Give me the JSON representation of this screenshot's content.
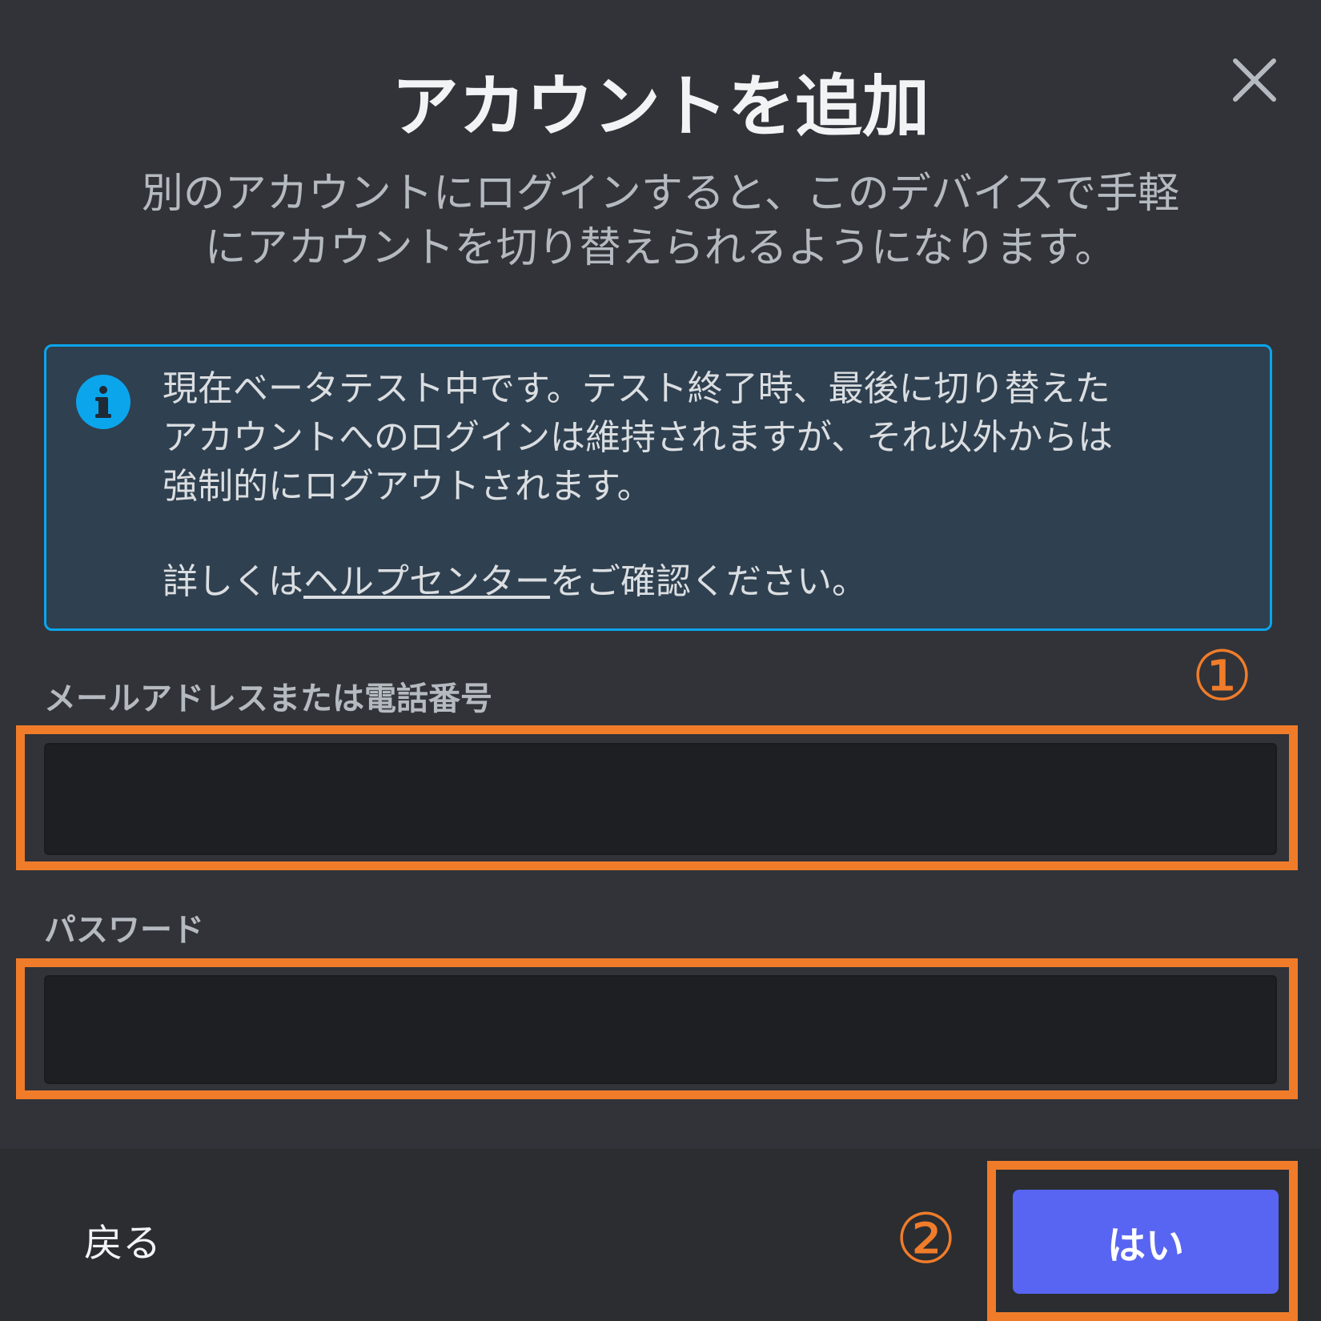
{
  "dialog": {
    "title": "アカウントを追加",
    "subtitle_lines": [
      "別のアカウントにログインすると、このデバイスで手軽",
      "にアカウントを切り替えられるようになります。"
    ],
    "close_icon": "close-icon"
  },
  "notice": {
    "icon": "info-icon",
    "lines": [
      "現在ベータテスト中です。テスト終了時、最後に切り替えた",
      "アカウントへのログインは維持されますが、それ以外からは",
      "強制的にログアウトされます。"
    ],
    "help_prefix": "詳しくは",
    "help_link": "ヘルプセンター",
    "help_suffix": "をご確認ください。"
  },
  "form": {
    "email_label": "メールアドレスまたは電話番号",
    "email_value": "",
    "password_label": "パスワード",
    "password_value": ""
  },
  "annotations": {
    "step_1": "①",
    "step_2": "②",
    "highlight_color": "#f07c2a"
  },
  "footer": {
    "back_label": "戻る",
    "yes_label": "はい"
  },
  "colors": {
    "accent": "#5865f2",
    "notice_border": "#0ba5ec",
    "background": "#313338"
  }
}
